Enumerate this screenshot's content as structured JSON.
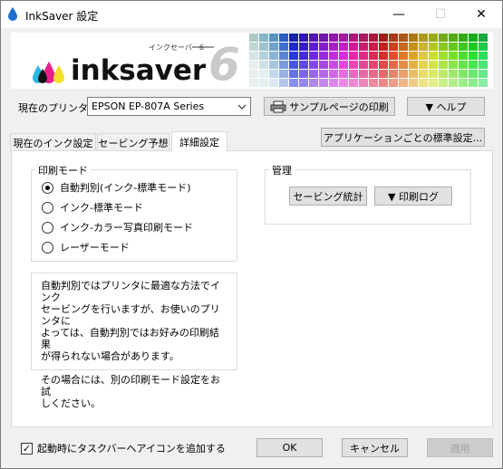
{
  "window": {
    "title": "InkSaver 設定",
    "minimize": "—",
    "maximize": "☐",
    "close": "✕"
  },
  "banner": {
    "katakana": "インクセーバー6",
    "brand": "inksaver",
    "version": "6"
  },
  "printer": {
    "label": "現在のプリンタ",
    "selected": "EPSON EP-807A Series",
    "sample_button": "サンプルページの印刷",
    "help_button": "▼ ヘルプ"
  },
  "app_defaults_button": "アプリケーションごとの標準設定...",
  "tabs": [
    {
      "label": "現在のインク設定",
      "active": false
    },
    {
      "label": "セービング予想",
      "active": false
    },
    {
      "label": "詳細設定",
      "active": true
    }
  ],
  "print_mode": {
    "title": "印刷モード",
    "options": [
      {
        "label": "自動判別(インク-標準モード)",
        "selected": true
      },
      {
        "label": "インク-標準モード",
        "selected": false
      },
      {
        "label": "インク-カラー写真印刷モード",
        "selected": false
      },
      {
        "label": "レーザーモード",
        "selected": false
      }
    ]
  },
  "management": {
    "title": "管理",
    "stats_button": "セービング統計",
    "log_button": "▼ 印刷ログ"
  },
  "info": {
    "line1": "自動判別ではプリンタに最適な方法でインク",
    "line2": "セービングを行いますが、お使いのプリンタに",
    "line3": "よっては、自動判別ではお好みの印刷結果",
    "line4": "が得られない場合があります。",
    "line5": "その場合には、別の印刷モード設定をお試",
    "line6": "しください。"
  },
  "footer": {
    "taskbar_checkbox_label": "起動時にタスクバーへアイコンを追加する",
    "taskbar_checked": true,
    "ok": "OK",
    "cancel": "キャンセル",
    "apply": "適用"
  },
  "colors": {
    "brand_blue": "#1a57b8",
    "brand_text": "#111111",
    "version_grey": "#c9c9c9"
  }
}
